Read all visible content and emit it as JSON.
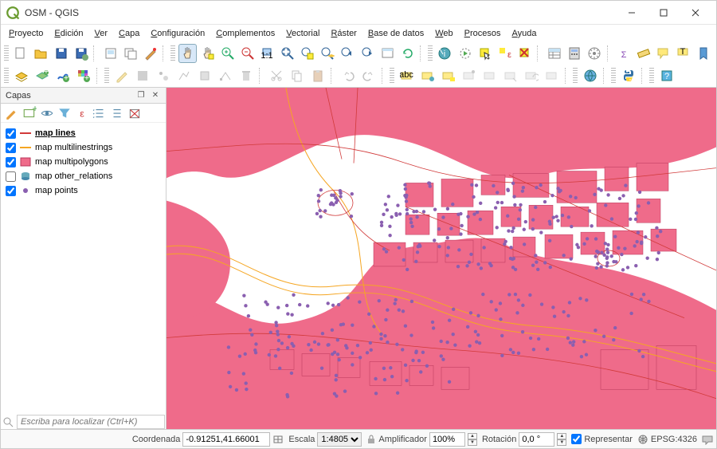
{
  "window": {
    "title": "OSM - QGIS"
  },
  "menus": [
    {
      "u": "P",
      "rest": "royecto"
    },
    {
      "u": "E",
      "rest": "dición"
    },
    {
      "u": "V",
      "rest": "er"
    },
    {
      "u": "C",
      "rest": "apa"
    },
    {
      "u": "C",
      "rest": "onfiguración"
    },
    {
      "u": "C",
      "rest": "omplementos"
    },
    {
      "u": "V",
      "rest": "ectorial"
    },
    {
      "u": "R",
      "rest": "áster"
    },
    {
      "u": "B",
      "rest": "ase de datos"
    },
    {
      "u": "W",
      "rest": "eb"
    },
    {
      "u": "P",
      "rest": "rocesos"
    },
    {
      "u": "A",
      "rest": "yuda"
    }
  ],
  "panel": {
    "title": "Capas"
  },
  "layers": [
    {
      "checked": true,
      "selected": true,
      "sym": "line-red",
      "label": "map lines"
    },
    {
      "checked": true,
      "selected": false,
      "sym": "line-orange",
      "label": "map multilinestrings"
    },
    {
      "checked": true,
      "selected": false,
      "sym": "poly-pink",
      "label": "map multipolygons"
    },
    {
      "checked": false,
      "selected": false,
      "sym": "db",
      "label": "map other_relations"
    },
    {
      "checked": true,
      "selected": false,
      "sym": "point-violet",
      "label": "map points"
    }
  ],
  "locator": {
    "placeholder": "Escriba para localizar (Ctrl+K)"
  },
  "status": {
    "coord_label": "Coordenada",
    "coord_value": "-0.91251,41.66001",
    "scale_label": "Escala",
    "scale_value": "1:4805",
    "mag_label": "Amplificador",
    "mag_value": "100%",
    "rot_label": "Rotación",
    "rot_value": "0,0 °",
    "render_label": "Representar",
    "crs_label": "EPSG:4326"
  }
}
